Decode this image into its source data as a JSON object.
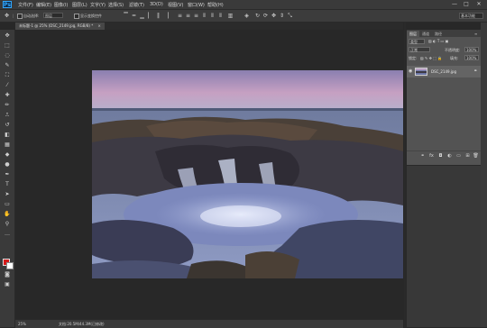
{
  "app": {
    "logo": "Ps"
  },
  "menu": [
    "文件(F)",
    "编辑(E)",
    "图像(I)",
    "图层(L)",
    "文字(Y)",
    "选择(S)",
    "滤镜(T)",
    "3D(D)",
    "视图(V)",
    "窗口(W)",
    "帮助(H)"
  ],
  "window_controls": {
    "minimize": "—",
    "maximize": "□",
    "close": "✕"
  },
  "options_bar": {
    "auto_select_label": "自动选择:",
    "auto_select_value": "图层",
    "show_transform_label": "显示变换控件",
    "workspace_value": "基本功能"
  },
  "document_tab": {
    "title": "未标题-1 @ 25% (DSC_2149.jpg, RGB/8) *",
    "close": "×"
  },
  "status_bar": {
    "zoom": "25%",
    "doc_info": "文档:20.5M/44.3M(已修改)"
  },
  "layers_panel": {
    "tabs": [
      "图层",
      "通道",
      "路径"
    ],
    "filter_kind": "类型",
    "blend_mode": "正常",
    "opacity_label": "不透明度:",
    "opacity_value": "100%",
    "lock_label": "锁定:",
    "fill_label": "填充:",
    "fill_value": "100%",
    "layer_name": "DSC_2149.jpg"
  },
  "icons": {
    "move": "✥",
    "marquee": "⬚",
    "lasso": "◌",
    "quick_select": "✎",
    "crop": "⛶",
    "eyedropper": "⁄",
    "healing": "✚",
    "brush": "✏",
    "stamp": "⎍",
    "history_brush": "↺",
    "eraser": "◧",
    "gradient": "▦",
    "blur": "◆",
    "dodge": "●",
    "pen": "✒",
    "type": "T",
    "path_select": "➤",
    "shape": "▭",
    "hand": "✋",
    "zoom": "⚲",
    "more": "…",
    "quick_mask": "◙",
    "screen_mode": "▣"
  },
  "colors": {
    "foreground": "#d41818",
    "background": "#ffffff",
    "accent": "#31a8ff"
  }
}
